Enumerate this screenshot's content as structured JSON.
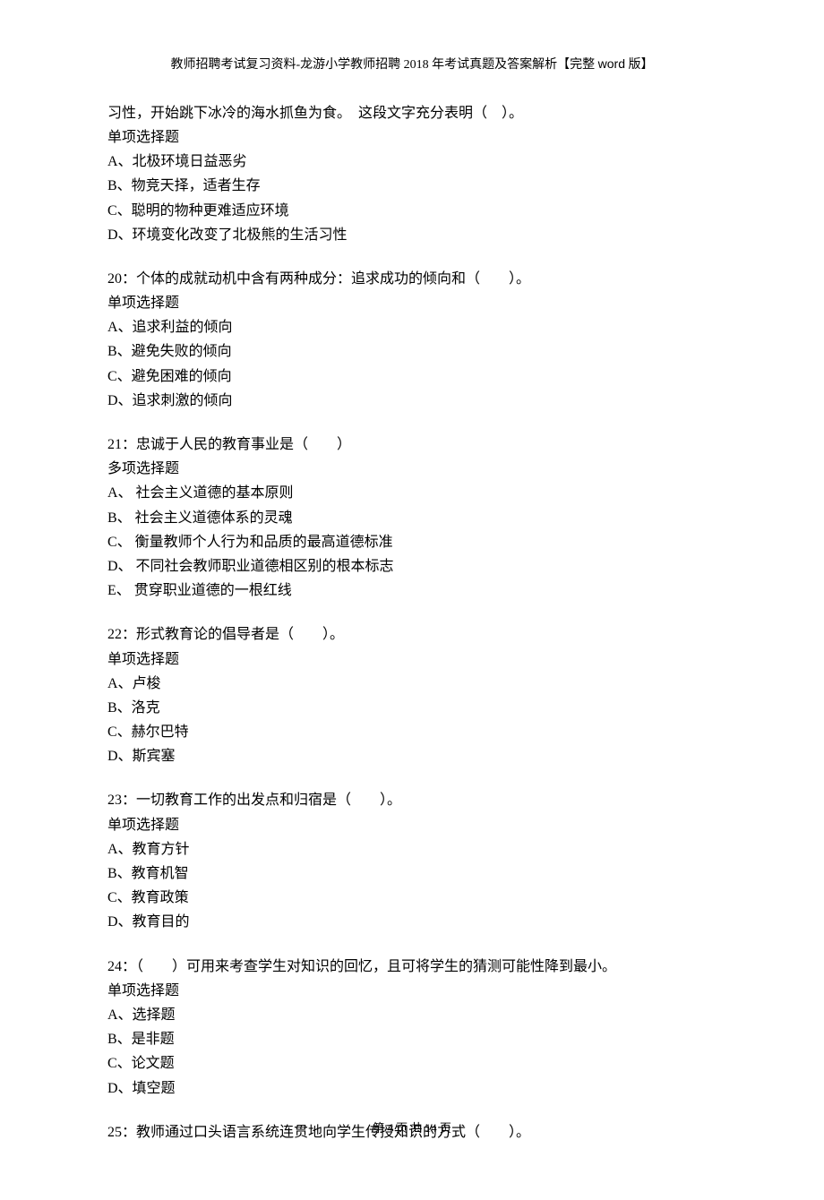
{
  "header": {
    "prefix": "教师招聘考试复习资料-龙游小学教师招聘 ",
    "year": "2018",
    "mid": " 年考试真题及答案解析【完整 ",
    "word": "word",
    "suffix": " 版】"
  },
  "footer": {
    "prefix": "第 ",
    "page": "4",
    "mid": " 页 共 ",
    "total": "14",
    "suffix": " 页"
  },
  "q19": {
    "cont_line": "习性，开始跳下冰冷的海水抓鱼为食。　这段文字充分表明（　）。",
    "type": "单项选择题",
    "A": "A、北极环境日益恶劣",
    "B": "B、物竞天择，适者生存",
    "C": "C、聪明的物种更难适应环境",
    "D": "D、环境变化改变了北极熊的生活习性"
  },
  "q20": {
    "stem": "20：个体的成就动机中含有两种成分：追求成功的倾向和（　　）。",
    "type": "单项选择题",
    "A": "A、追求利益的倾向",
    "B": "B、避免失败的倾向",
    "C": "C、避免困难的倾向",
    "D": "D、追求刺激的倾向"
  },
  "q21": {
    "stem": "21：忠诚于人民的教育事业是（　　）",
    "type": "多项选择题",
    "A": "A、 社会主义道德的基本原则",
    "B": "B、 社会主义道德体系的灵魂",
    "C": "C、 衡量教师个人行为和品质的最高道德标准",
    "D": "D、 不同社会教师职业道德相区别的根本标志",
    "E": "E、 贯穿职业道德的一根红线"
  },
  "q22": {
    "stem": "22：形式教育论的倡导者是（　　）。",
    "type": "单项选择题",
    "A": "A、卢梭",
    "B": "B、洛克",
    "C": "C、赫尔巴特",
    "D": "D、斯宾塞"
  },
  "q23": {
    "stem": "23：一切教育工作的出发点和归宿是（　　）。",
    "type": "单项选择题",
    "A": "A、教育方针",
    "B": "B、教育机智",
    "C": "C、教育政策",
    "D": "D、教育目的"
  },
  "q24": {
    "stem": "24：（　　）可用来考查学生对知识的回忆，且可将学生的猜测可能性降到最小。",
    "type": "单项选择题",
    "A": "A、选择题",
    "B": "B、是非题",
    "C": "C、论文题",
    "D": "D、填空题"
  },
  "q25": {
    "stem": "25：教师通过口头语言系统连贯地向学生传授知识的方式（　　）。"
  }
}
